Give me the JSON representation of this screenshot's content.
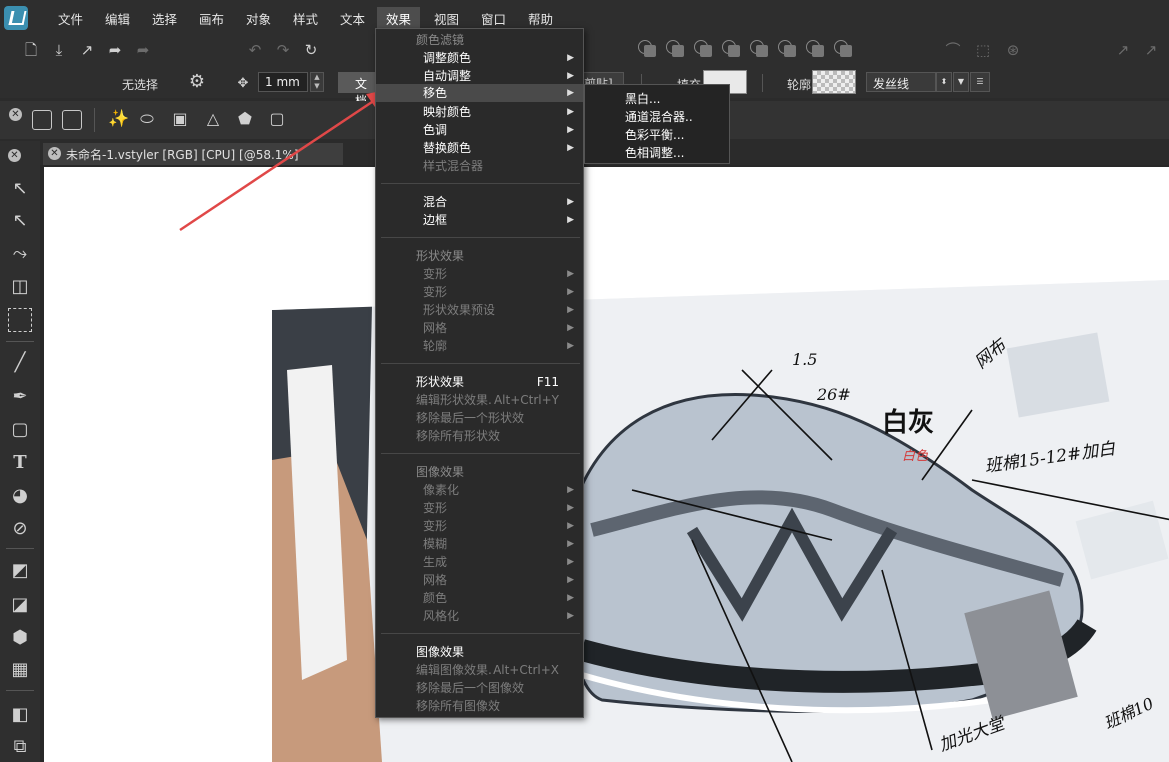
{
  "menubar": {
    "items": [
      "文件",
      "编辑",
      "选择",
      "画布",
      "对象",
      "样式",
      "文本",
      "效果",
      "视图",
      "窗口",
      "帮助"
    ],
    "active": "效果"
  },
  "propbar": {
    "no_selection": "无选择",
    "stroke_width": "1 mm",
    "doc_button": "文档",
    "clip_button": "剪贴]",
    "fill_label": "填充",
    "stroke_label": "轮廓",
    "stroke_style": "发丝线"
  },
  "document_tab": {
    "title": "未命名-1.vstyler [RGB] [CPU] [@58.1%]"
  },
  "effects_menu": {
    "color_filter_header": "颜色滤镜",
    "adjust_color": "调整颜色",
    "auto_adjust": "自动调整",
    "shift_color": "移色",
    "map_color": "映射颜色",
    "tone": "色调",
    "replace_color": "替换颜色",
    "style_blend": "样式混合器",
    "blend": "混合",
    "border": "边框",
    "shape_effects_header": "形状效果",
    "transform1": "变形",
    "transform2": "变形",
    "shape_effects_preset": "形状效果预设",
    "mesh": "网格",
    "outline": "轮廓",
    "shape_effects": "形状效果",
    "shape_effects_shortcut": "F11",
    "edit_shape_effects": "编辑形状效果.",
    "edit_shape_effects_shortcut": "Alt+Ctrl+Y",
    "remove_last_shape": "移除最后一个形状效",
    "remove_all_shape": "移除所有形状效",
    "image_effects_header": "图像效果",
    "pixelate": "像素化",
    "img_transform1": "变形",
    "img_transform2": "变形",
    "blur": "模糊",
    "generate": "生成",
    "img_mesh": "网格",
    "img_color": "颜色",
    "stylize": "风格化",
    "image_effects": "图像效果",
    "edit_image_effects": "编辑图像效果.",
    "edit_image_effects_shortcut": "Alt+Ctrl+X",
    "remove_last_image": "移除最后一个图像效",
    "remove_all_image": "移除所有图像效"
  },
  "shift_color_submenu": {
    "black_white": "黑白...",
    "channel_mixer": "通道混合器..",
    "color_balance": "色彩平衡...",
    "hue_adjust": "色相调整..."
  },
  "photo_notes": {
    "white_gray": "白灰",
    "red_note": "白色",
    "n1": "1.5",
    "n2": "26#",
    "n3": "班棉15-12#加白",
    "n4": "加光大堂",
    "n5": "班棉10",
    "n6": "网布"
  },
  "colors": {
    "accent_logo": "#3b8fb0",
    "menu_bg": "#2a2a2a",
    "menu_highlight": "#4a4a4a",
    "annotation_arrow": "#e04848"
  }
}
